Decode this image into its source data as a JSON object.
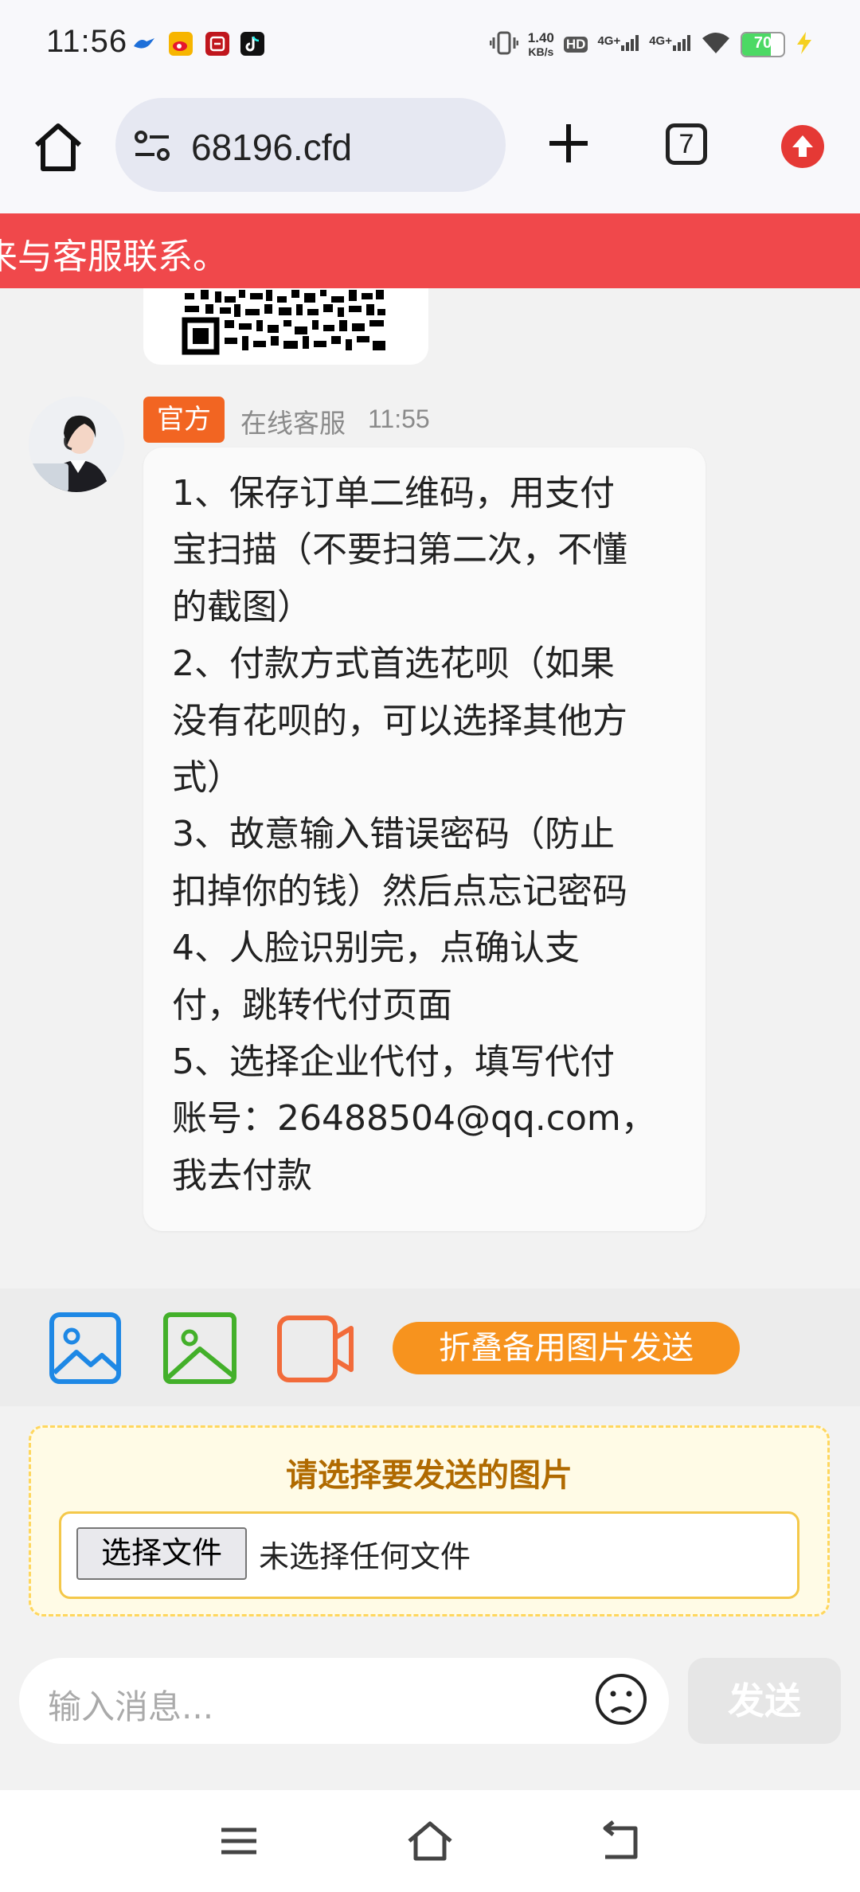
{
  "status_bar": {
    "time": "11:56",
    "net_speed": "1.40",
    "net_unit": "KB/s",
    "hd": "HD",
    "sig1": "4G+",
    "sig2": "4G+",
    "battery": "70",
    "battery_level": 0.7,
    "colors": {
      "battery_fill": "#4cd964",
      "charging": "#f5d020"
    }
  },
  "browser": {
    "url": "68196.cfd",
    "tab_count": "7",
    "icons": [
      "home-icon",
      "site-settings-icon",
      "new-tab-icon",
      "tab-switcher-icon",
      "update-icon"
    ]
  },
  "banner": {
    "text": "来与客服联系。",
    "color": "#f0484b"
  },
  "chat": {
    "badge": "官方",
    "sender": "在线客服",
    "time": "11:55",
    "message_lines": [
      "1、保存订单二维码，用支付",
      "宝扫描（不要扫第二次，不懂",
      "的截图）",
      "2、付款方式首选花呗（如果",
      "没有花呗的，可以选择其他方",
      "式）",
      "3、故意输入错误密码（防止",
      "扣掉你的钱）然后点忘记密码",
      "4、人脸识别完，点确认支",
      "付，跳转代付页面",
      "5、选择企业代付，填写代付",
      "账号：26488504@qq.com，",
      "我去付款"
    ]
  },
  "attach": {
    "fold_button": "折叠备用图片发送",
    "icons": [
      "image-icon-blue",
      "image-icon-green",
      "video-icon"
    ],
    "colors": {
      "blue": "#1e88e5",
      "green": "#43b02a",
      "orange": "#f26b3a",
      "fold": "#f7931e"
    }
  },
  "file_panel": {
    "title": "请选择要发送的图片",
    "choose_label": "选择文件",
    "status": "未选择任何文件"
  },
  "input": {
    "placeholder": "输入消息...",
    "send_label": "发送"
  }
}
